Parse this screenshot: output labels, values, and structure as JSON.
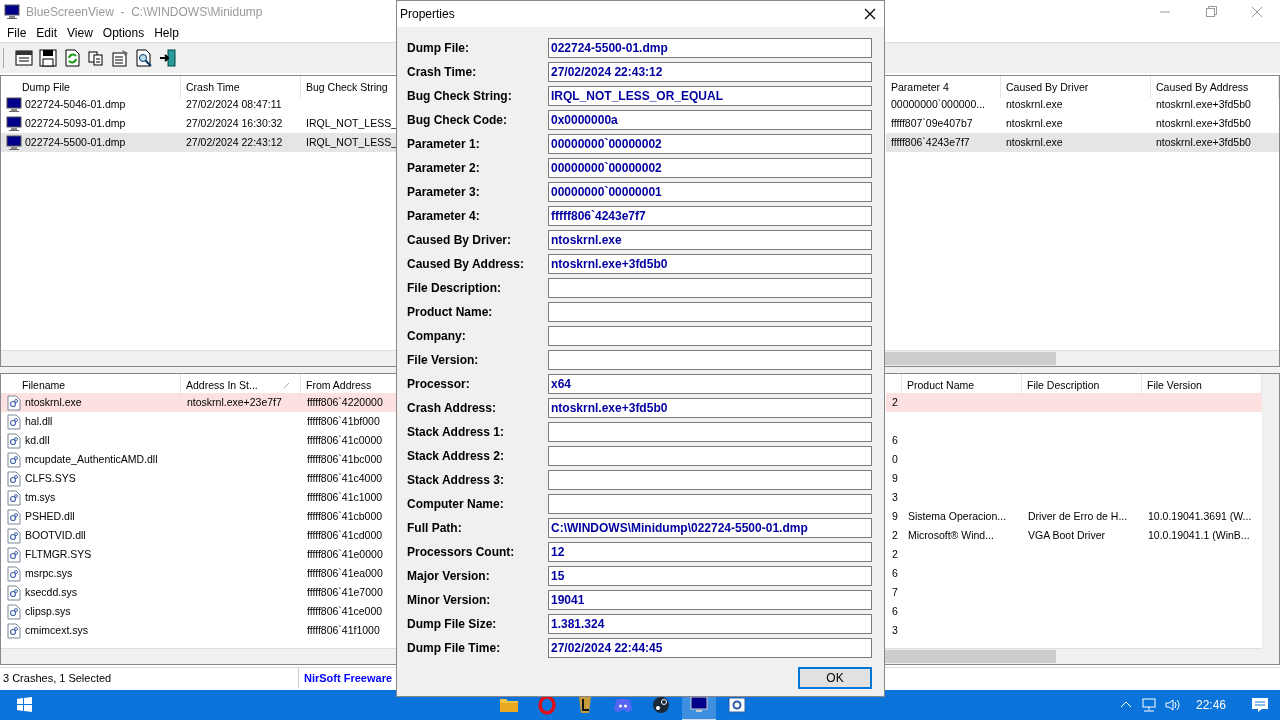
{
  "window": {
    "title": "BlueScreenView  -  C:\\WINDOWS\\Minidump"
  },
  "menu": [
    "File",
    "Edit",
    "View",
    "Options",
    "Help"
  ],
  "crash_list": {
    "columns": [
      {
        "label": "Dump File"
      },
      {
        "label": "Crash Time"
      },
      {
        "label": "Bug Check String"
      },
      {
        "label": "Parameter 4"
      },
      {
        "label": "Caused By Driver"
      },
      {
        "label": "Caused By Address"
      }
    ],
    "rows": [
      {
        "cells": [
          "022724-5046-01.dmp",
          "27/02/2024 08:47:11",
          "",
          "00000000`000000...",
          "ntoskrnl.exe",
          "ntoskrnl.exe+3fd5b0"
        ],
        "selected": false
      },
      {
        "cells": [
          "022724-5093-01.dmp",
          "27/02/2024 16:30:32",
          "IRQL_NOT_LESS_",
          "fffff807`09e407b7",
          "ntoskrnl.exe",
          "ntoskrnl.exe+3fd5b0"
        ],
        "selected": false
      },
      {
        "cells": [
          "022724-5500-01.dmp",
          "27/02/2024 22:43:12",
          "IRQL_NOT_LESS_",
          "fffff806`4243e7f7",
          "ntoskrnl.exe",
          "ntoskrnl.exe+3fd5b0"
        ],
        "selected": true
      }
    ]
  },
  "driver_list": {
    "columns": [
      {
        "label": "Filename",
        "sorted": false
      },
      {
        "label": "Address In St...",
        "sorted": true
      },
      {
        "label": "From Address",
        "sorted": false
      },
      {
        "sorted": false
      },
      {
        "label": "Product Name",
        "sorted": false
      },
      {
        "label": "File Description",
        "sorted": false
      },
      {
        "label": "File Version",
        "sorted": false
      }
    ],
    "rows": [
      {
        "cells": [
          "ntoskrnl.exe",
          "ntoskrnl.exe+23e7f7",
          "fffff806`4220000",
          "2",
          "",
          "",
          ""
        ],
        "highlighted": true
      },
      {
        "cells": [
          "hal.dll",
          "",
          "fffff806`41bf000",
          "",
          "",
          "",
          ""
        ],
        "highlighted": false
      },
      {
        "cells": [
          "kd.dll",
          "",
          "fffff806`41c0000",
          "6",
          "",
          "",
          ""
        ],
        "highlighted": false
      },
      {
        "cells": [
          "mcupdate_AuthenticAMD.dll",
          "",
          "fffff806`41bc000",
          "0",
          "",
          "",
          ""
        ],
        "highlighted": false
      },
      {
        "cells": [
          "CLFS.SYS",
          "",
          "fffff806`41c4000",
          "9",
          "",
          "",
          ""
        ],
        "highlighted": false
      },
      {
        "cells": [
          "tm.sys",
          "",
          "fffff806`41c1000",
          "3",
          "",
          "",
          ""
        ],
        "highlighted": false
      },
      {
        "cells": [
          "PSHED.dll",
          "",
          "fffff806`41cb000",
          "9",
          "Sistema Operacion...",
          "Driver de Erro de H...",
          "10.0.19041.3691 (W..."
        ],
        "highlighted": false
      },
      {
        "cells": [
          "BOOTVID.dll",
          "",
          "fffff806`41cd000",
          "2",
          "Microsoft® Wind...",
          "VGA Boot Driver",
          "10.0.19041.1 (WinB..."
        ],
        "highlighted": false
      },
      {
        "cells": [
          "FLTMGR.SYS",
          "",
          "fffff806`41e0000",
          "2",
          "",
          "",
          ""
        ],
        "highlighted": false
      },
      {
        "cells": [
          "msrpc.sys",
          "",
          "fffff806`41ea000",
          "6",
          "",
          "",
          ""
        ],
        "highlighted": false
      },
      {
        "cells": [
          "ksecdd.sys",
          "",
          "fffff806`41e7000",
          "7",
          "",
          "",
          ""
        ],
        "highlighted": false
      },
      {
        "cells": [
          "clipsp.sys",
          "",
          "fffff806`41ce000",
          "6",
          "",
          "",
          ""
        ],
        "highlighted": false
      },
      {
        "cells": [
          "cmimcext.sys",
          "",
          "fffff806`41f1000",
          "3",
          "",
          "",
          ""
        ],
        "highlighted": false
      }
    ]
  },
  "status_bar": [
    "3 Crashes, 1 Selected",
    "NirSoft Freeware"
  ],
  "dialog": {
    "title": "Properties",
    "fields": [
      {
        "label": "Dump File:",
        "value": "022724-5500-01.dmp"
      },
      {
        "label": "Crash Time:",
        "value": "27/02/2024 22:43:12"
      },
      {
        "label": "Bug Check String:",
        "value": "IRQL_NOT_LESS_OR_EQUAL"
      },
      {
        "label": "Bug Check Code:",
        "value": "0x0000000a"
      },
      {
        "label": "Parameter 1:",
        "value": "00000000`00000002"
      },
      {
        "label": "Parameter 2:",
        "value": "00000000`00000002"
      },
      {
        "label": "Parameter 3:",
        "value": "00000000`00000001"
      },
      {
        "label": "Parameter 4:",
        "value": "fffff806`4243e7f7"
      },
      {
        "label": "Caused By Driver:",
        "value": "ntoskrnl.exe"
      },
      {
        "label": "Caused By Address:",
        "value": "ntoskrnl.exe+3fd5b0"
      },
      {
        "label": "File Description:"
      },
      {
        "label": "Product Name:"
      },
      {
        "label": "Company:"
      },
      {
        "label": "File Version:"
      },
      {
        "label": "Processor:",
        "value": "x64"
      },
      {
        "label": "Crash Address:",
        "value": "ntoskrnl.exe+3fd5b0"
      },
      {
        "label": "Stack Address 1:"
      },
      {
        "label": "Stack Address 2:"
      },
      {
        "label": "Stack Address 3:"
      },
      {
        "label": "Computer Name:"
      },
      {
        "label": "Full Path:",
        "value": "C:\\WINDOWS\\Minidump\\022724-5500-01.dmp"
      },
      {
        "label": "Processors Count:",
        "value": "12"
      },
      {
        "label": "Major Version:",
        "value": "15"
      },
      {
        "label": "Minor Version:",
        "value": "19041"
      },
      {
        "label": "Dump File Size:",
        "value": "1.381.324"
      },
      {
        "label": "Dump File Time:",
        "value": "27/02/2024 22:44:45"
      }
    ],
    "ok_button": "OK"
  },
  "taskbar": {
    "apps": [
      {
        "kind": "folder",
        "active": false
      },
      {
        "kind": "opera",
        "active": false
      },
      {
        "kind": "game",
        "active": false
      },
      {
        "kind": "discord",
        "active": false
      },
      {
        "kind": "steam",
        "active": false
      },
      {
        "kind": "bluescreen",
        "active": true
      },
      {
        "kind": "settings",
        "active": false
      }
    ],
    "time": "22:46"
  }
}
